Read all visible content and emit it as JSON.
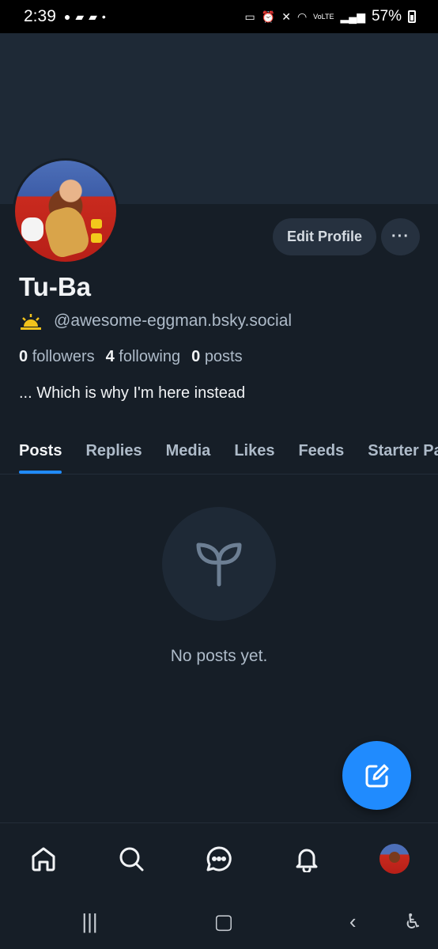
{
  "status_bar": {
    "time": "2:39",
    "battery": "57%",
    "network": "VoLTE"
  },
  "profile": {
    "display_name": "Tu-Ba",
    "handle": "@awesome-eggman.bsky.social",
    "followers_count": "0",
    "followers_label": "followers",
    "following_count": "4",
    "following_label": "following",
    "posts_count": "0",
    "posts_label": "posts",
    "bio": "... Which is why I'm here instead",
    "edit_label": "Edit Profile",
    "more_label": "···"
  },
  "tabs": [
    {
      "label": "Posts",
      "active": true
    },
    {
      "label": "Replies"
    },
    {
      "label": "Media"
    },
    {
      "label": "Likes"
    },
    {
      "label": "Feeds"
    },
    {
      "label": "Starter Packs"
    }
  ],
  "empty_state": {
    "message": "No posts yet.",
    "icon": "sprout-icon"
  },
  "bottom_nav": [
    "home-icon",
    "search-icon",
    "chat-icon",
    "bell-icon",
    "profile-avatar"
  ],
  "colors": {
    "accent": "#208bfe",
    "background": "#161e27",
    "banner": "#1e2936"
  }
}
